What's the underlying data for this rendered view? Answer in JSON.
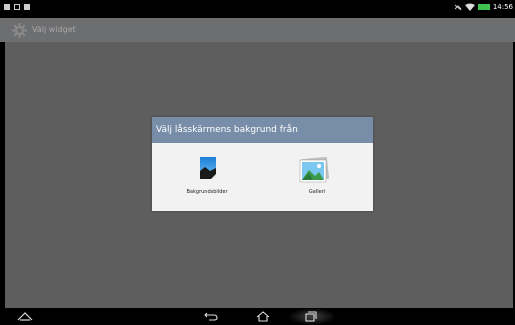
{
  "action_bar": {
    "title": "Välj widget"
  },
  "status_bar": {
    "time": "14:56"
  },
  "dialog": {
    "title": "Välj låsskärmens bakgrund från",
    "options": [
      {
        "label": "Bakgrundsbilder",
        "icon": "wallpaper-icon"
      },
      {
        "label": "Galleri",
        "icon": "gallery-icon"
      }
    ]
  },
  "colors": {
    "dialog_header": "#788ea8",
    "backdrop": "#5e5e5e",
    "action_bar": "#6d6e70"
  }
}
